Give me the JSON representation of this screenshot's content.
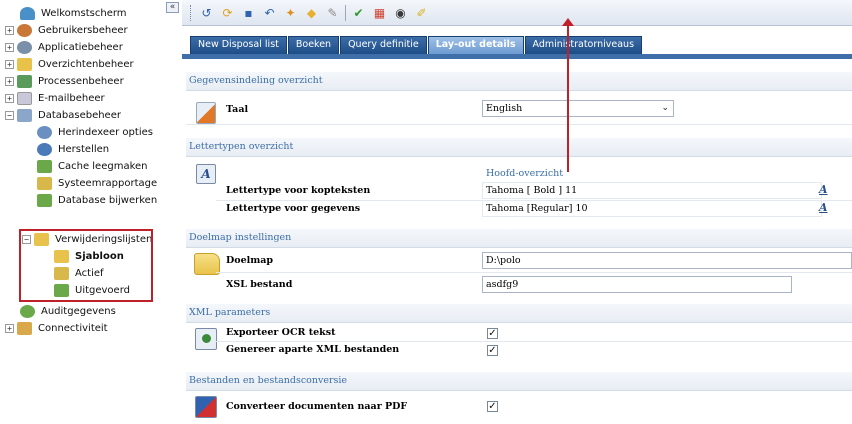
{
  "sidebar": {
    "collapse_label": "«",
    "items": [
      {
        "label": "Welkomstscherm",
        "icon": "welcome-icon",
        "color": "#4a90c8"
      },
      {
        "label": "Gebruikersbeheer",
        "icon": "users-icon",
        "color": "#c9783a"
      },
      {
        "label": "Applicatiebeheer",
        "icon": "application-icon",
        "color": "#7a8fa8"
      },
      {
        "label": "Overzichtenbeheer",
        "icon": "folder-icon",
        "color": "#e8c24a"
      },
      {
        "label": "Processenbeheer",
        "icon": "process-icon",
        "color": "#5a9a5a"
      },
      {
        "label": "E-mailbeheer",
        "icon": "email-icon",
        "color": "#c8c8d8"
      },
      {
        "label": "Databasebeheer",
        "icon": "database-icon",
        "color": "#8aa6c8"
      },
      {
        "label": "Herindexeer opties",
        "icon": "reindex-icon",
        "color": "#6a8fc0"
      },
      {
        "label": "Herstellen",
        "icon": "restore-icon",
        "color": "#4a7ab8"
      },
      {
        "label": "Cache leegmaken",
        "icon": "cache-icon",
        "color": "#6aa84a"
      },
      {
        "label": "Systeemrapportage",
        "icon": "report-icon",
        "color": "#d8b84a"
      },
      {
        "label": "Database bijwerken",
        "icon": "update-icon",
        "color": "#6aa84a"
      },
      {
        "label": "Verwijderingslijsten",
        "icon": "folder-icon",
        "color": "#e8c24a"
      },
      {
        "label": "Sjabloon",
        "icon": "template-icon",
        "color": "#e8c24a"
      },
      {
        "label": "Actief",
        "icon": "active-icon",
        "color": "#d8b84a"
      },
      {
        "label": "Uitgevoerd",
        "icon": "done-icon",
        "color": "#6aa84a"
      },
      {
        "label": "Auditgegevens",
        "icon": "audit-icon",
        "color": "#6aa84a"
      },
      {
        "label": "Connectiviteit",
        "icon": "connectivity-icon",
        "color": "#d8a84a"
      }
    ]
  },
  "toolbar": {
    "buttons": [
      {
        "icon": "back-icon",
        "glyph": "↺",
        "color": "#2f62b0"
      },
      {
        "icon": "refresh-icon",
        "glyph": "⟳",
        "color": "#e0a020"
      },
      {
        "icon": "save-icon",
        "glyph": "▪",
        "color": "#2f62b0"
      },
      {
        "icon": "undo-icon",
        "glyph": "↶",
        "color": "#2f62b0"
      },
      {
        "icon": "search-icon",
        "glyph": "✦",
        "color": "#e09020"
      },
      {
        "icon": "tag-icon",
        "glyph": "◆",
        "color": "#e8b030"
      },
      {
        "icon": "edit-icon",
        "glyph": "✎",
        "color": "#8a8a8a"
      },
      {
        "icon": "check-icon",
        "glyph": "✔",
        "color": "#2e9a2e"
      },
      {
        "icon": "layout-icon",
        "glyph": "▦",
        "color": "#d04030"
      },
      {
        "icon": "preview-icon",
        "glyph": "◉",
        "color": "#3a3a3a"
      },
      {
        "icon": "pencil-icon",
        "glyph": "✐",
        "color": "#d8b020"
      }
    ]
  },
  "tabs": [
    {
      "label": "New Disposal list",
      "active": false
    },
    {
      "label": "Boeken",
      "active": false
    },
    {
      "label": "Query definitie",
      "active": false
    },
    {
      "label": "Lay-out details",
      "active": true
    },
    {
      "label": "Administratorniveaus",
      "active": false
    }
  ],
  "sections": {
    "data_layout": "Gegevensindeling overzicht",
    "fonts": "Lettertypen overzicht",
    "target": "Doelmap instellingen",
    "xml": "XML parameters",
    "conversion": "Bestanden en bestandsconversie"
  },
  "language": {
    "label": "Taal",
    "value": "English"
  },
  "fonts": {
    "column_header": "Hoofd-overzicht",
    "header_font_label": "Lettertype voor kopteksten",
    "header_font_value": "Tahoma [ Bold ] 11",
    "data_font_label": "Lettertype voor gegevens",
    "data_font_value": "Tahoma [Regular] 10",
    "font_button_glyph": "A"
  },
  "target": {
    "folder_label": "Doelmap",
    "folder_value": "D:\\polo",
    "xsl_label": "XSL bestand",
    "xsl_value": "asdfg9"
  },
  "xml": {
    "ocr_label": "Exporteer OCR tekst",
    "ocr_checked": true,
    "separate_label": "Genereer aparte XML bestanden",
    "separate_checked": true
  },
  "conversion": {
    "pdf_label": "Converteer documenten naar PDF",
    "pdf_checked": true
  },
  "colors": {
    "accent": "#3b6ea5",
    "tab_bg": "#1e4d86",
    "tab_active": "#6d9bd1",
    "annotation": "#c0202a"
  }
}
